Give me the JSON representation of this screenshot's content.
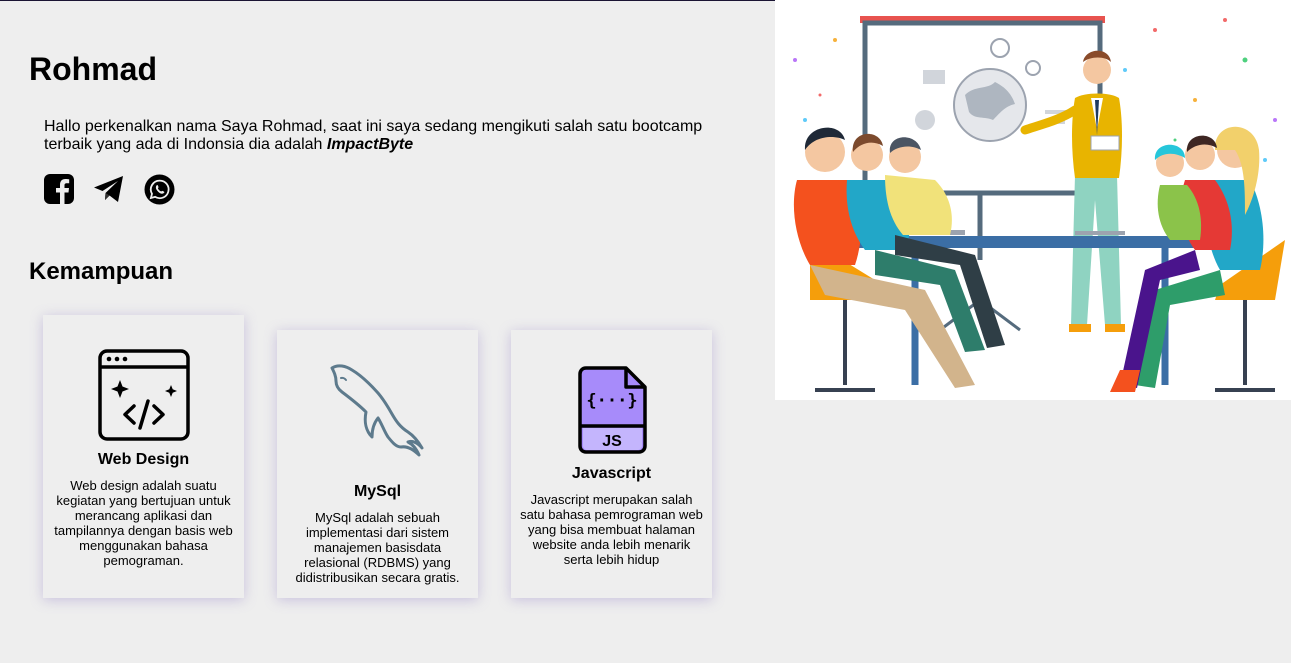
{
  "profile": {
    "name": "Rohmad",
    "intro_text": "Hallo perkenalkan nama Saya Rohmad, saat ini saya sedang mengikuti salah satu bootcamp terbaik yang ada di Indonsia dia adalah ",
    "intro_emphasis": "ImpactByte"
  },
  "socials": [
    {
      "icon": "facebook-icon"
    },
    {
      "icon": "telegram-icon"
    },
    {
      "icon": "whatsapp-icon"
    }
  ],
  "skills": {
    "heading": "Kemampuan",
    "cards": [
      {
        "title": "Web Design",
        "icon": "web-design-icon",
        "text": "Web design adalah suatu kegiatan yang bertujuan untuk merancang aplikasi dan tampilannya dengan basis web menggunakan bahasa pemograman."
      },
      {
        "title": "MySql",
        "icon": "mysql-dolphin-icon",
        "text": "MySql adalah sebuah implementasi dari sistem manajemen basisdata relasional (RDBMS) yang didistribusikan secara gratis."
      },
      {
        "title": "Javascript",
        "icon": "javascript-file-icon",
        "icon_label": "JS",
        "icon_braces": "{···}",
        "text": "Javascript merupakan salah satu bahasa pemrograman web yang bisa membuat halaman website anda lebih menarik serta lebih hidup"
      }
    ]
  },
  "colors": {
    "background": "#eeeeee",
    "card_shadow": "#c9bfe6",
    "js_icon_fill": "#a78bfa",
    "mysql_icon": "#5d7a8c",
    "board_red": "#e8534f"
  }
}
